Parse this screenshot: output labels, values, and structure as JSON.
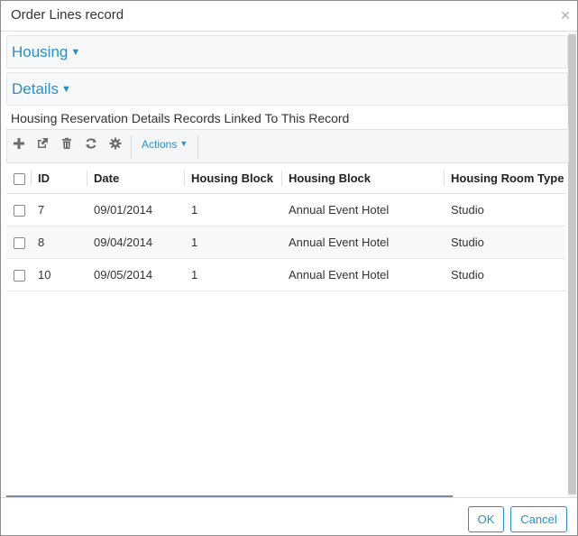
{
  "dialog": {
    "title": "Order Lines record",
    "close_icon": "close-icon"
  },
  "sections": {
    "housing_label": "Housing",
    "details_label": "Details"
  },
  "linked": {
    "title": "Housing Reservation Details Records Linked To This Record"
  },
  "toolbar": {
    "icons": [
      "plus-icon",
      "external-link-icon",
      "trash-icon",
      "refresh-icon",
      "gear-icon"
    ],
    "actions_label": "Actions"
  },
  "table": {
    "columns": [
      "ID",
      "Date",
      "Housing Block",
      "Housing Block",
      "Housing Room Type"
    ],
    "rows": [
      {
        "id": "7",
        "date": "09/01/2014",
        "housing_block_id": "1",
        "housing_block": "Annual Event Hotel",
        "room_type": "Studio"
      },
      {
        "id": "8",
        "date": "09/04/2014",
        "housing_block_id": "1",
        "housing_block": "Annual Event Hotel",
        "room_type": "Studio"
      },
      {
        "id": "10",
        "date": "09/05/2014",
        "housing_block_id": "1",
        "housing_block": "Annual Event Hotel",
        "room_type": "Studio"
      }
    ]
  },
  "footer": {
    "ok_label": "OK",
    "cancel_label": "Cancel"
  },
  "colors": {
    "accent": "#2a8fc7"
  }
}
